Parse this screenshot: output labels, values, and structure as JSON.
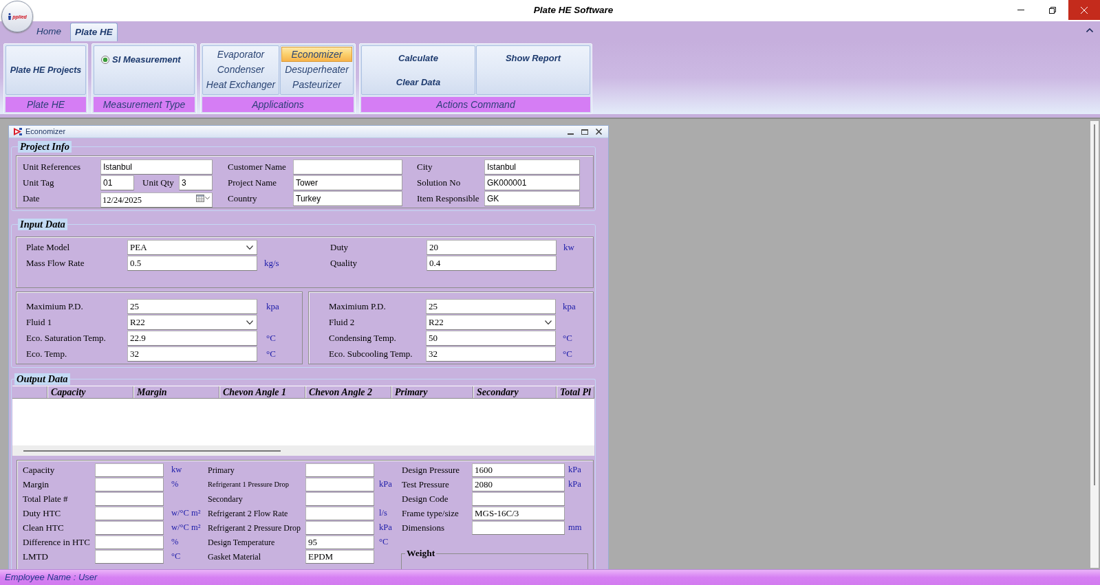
{
  "window": {
    "title": "Plate HE Software"
  },
  "app_logo": {
    "text": "pplied"
  },
  "ribbon": {
    "tabs": [
      {
        "label": "Home",
        "selected": false
      },
      {
        "label": "Plate HE",
        "selected": true
      }
    ],
    "groups": [
      {
        "kind": "buttons",
        "label": "Plate HE",
        "buttons": [
          "Plate HE Projects"
        ]
      },
      {
        "kind": "radios",
        "label": "Measurement Type",
        "options": [
          {
            "label": "SI Measurement",
            "selected": true
          }
        ]
      },
      {
        "kind": "list",
        "label": "Applications",
        "items": [
          {
            "label": "Evaporator",
            "selected": false
          },
          {
            "label": "Condenser",
            "selected": false
          },
          {
            "label": "Heat Exchanger",
            "selected": false
          },
          {
            "label": "Economizer",
            "selected": true
          },
          {
            "label": "Desuperheater",
            "selected": false
          },
          {
            "label": "Pasteurizer",
            "selected": false
          }
        ]
      },
      {
        "kind": "columns",
        "label": "Actions Command",
        "columns": [
          [
            "Calculate",
            "Clear Data"
          ],
          [
            "Show Report"
          ]
        ]
      }
    ]
  },
  "child_window": {
    "title": "Economizer",
    "project_info": {
      "title": "Project Info",
      "columns": [
        [
          {
            "kind": "text",
            "label": "Unit References",
            "value": "Istanbul"
          },
          {
            "kind": "pair",
            "label": "Unit Tag",
            "value": "01",
            "label_2": "Unit Qty",
            "value_2": "3"
          },
          {
            "kind": "date",
            "label": "Date",
            "value": "12/24/2025"
          }
        ],
        [
          {
            "kind": "text",
            "label": "Customer Name"
          },
          {
            "kind": "text",
            "label": "Project Name",
            "value": "Tower"
          },
          {
            "kind": "text",
            "label": "Country",
            "value": "Turkey"
          }
        ],
        [
          {
            "kind": "text",
            "label": "City",
            "value": "Istanbul"
          },
          {
            "kind": "text",
            "label": "Solution No",
            "value": "GK000001"
          },
          {
            "kind": "text",
            "label": "Item Responsible",
            "value": "GK"
          }
        ]
      ]
    },
    "input_data": {
      "title": "Input Data",
      "general": [
        [
          {
            "kind": "select",
            "label": "Plate Model",
            "value": "PEA"
          },
          {
            "kind": "text",
            "label": "Mass Flow Rate",
            "value": "0.5",
            "unit": "kg/s"
          }
        ],
        [
          {
            "kind": "text",
            "label": "Duty",
            "value": "20",
            "unit": "kw"
          },
          {
            "kind": "text",
            "label": "Quality",
            "value": "0.4"
          }
        ]
      ],
      "fluids": [
        [
          {
            "kind": "text",
            "label": "Maximium P.D.",
            "value": "25",
            "unit": "kpa"
          },
          {
            "kind": "select",
            "label": "Fluid 1",
            "value": "R22"
          },
          {
            "kind": "text",
            "label": "Eco. Saturation Temp.",
            "value": "22.9",
            "unit": "°C"
          },
          {
            "kind": "text",
            "label": "Eco. Temp.",
            "value": "32",
            "unit": "°C"
          }
        ],
        [
          {
            "kind": "text",
            "label": "Maximium P.D.",
            "value": "25",
            "unit": "kpa"
          },
          {
            "kind": "select",
            "label": "Fluid 2",
            "value": "R22"
          },
          {
            "kind": "text",
            "label": "Condensing Temp.",
            "value": "50",
            "unit": "°C"
          },
          {
            "kind": "text",
            "label": "Eco. Subcooling Temp.",
            "value": "32",
            "unit": "°C"
          }
        ]
      ]
    },
    "output_data": {
      "title": "Output Data",
      "table": {
        "columns": [
          "Capacity",
          "Margin",
          "Chevon Angle 1",
          "Chevon Angle 2",
          "Primary",
          "Secondary",
          "Total Pl"
        ]
      },
      "results": {
        "columns": [
          [
            {
              "label": "Capacity",
              "unit": "kw"
            },
            {
              "label": "Margin",
              "unit": "%"
            },
            {
              "label": "Total Plate #"
            },
            {
              "label": "Duty HTC",
              "unit": "w/°C m²"
            },
            {
              "label": "Clean HTC",
              "unit": "w/°C m²"
            },
            {
              "label": "Difference in HTC",
              "unit": "%"
            },
            {
              "label": "LMTD",
              "unit": "°C"
            }
          ],
          [
            {
              "label": "Primary"
            },
            {
              "label": "Refrigerant 1 Pressure Drop",
              "unit": "kPa"
            },
            {
              "label": "Secondary"
            },
            {
              "label": "Refrigerant 2 Flow Rate",
              "unit": "l/s"
            },
            {
              "label": "Refrigerant 2 Pressure Drop",
              "unit": "kPa"
            },
            {
              "label": "Design Temperature",
              "value": "95",
              "unit": "°C"
            },
            {
              "label": "Gasket Material",
              "value": "EPDM"
            }
          ],
          [
            {
              "label": "Design Pressure",
              "value": "1600",
              "unit": "kPa"
            },
            {
              "label": "Test Pressure",
              "value": "2080",
              "unit": "kPa"
            },
            {
              "label": "Design Code"
            },
            {
              "label": "Frame type/size",
              "value": "MGS-16C/3"
            },
            {
              "label": "Dimensions",
              "unit": "mm"
            }
          ]
        ],
        "weight": {
          "title": "Weight"
        }
      }
    }
  },
  "status_bar": {
    "text": "Employee Name : User"
  }
}
